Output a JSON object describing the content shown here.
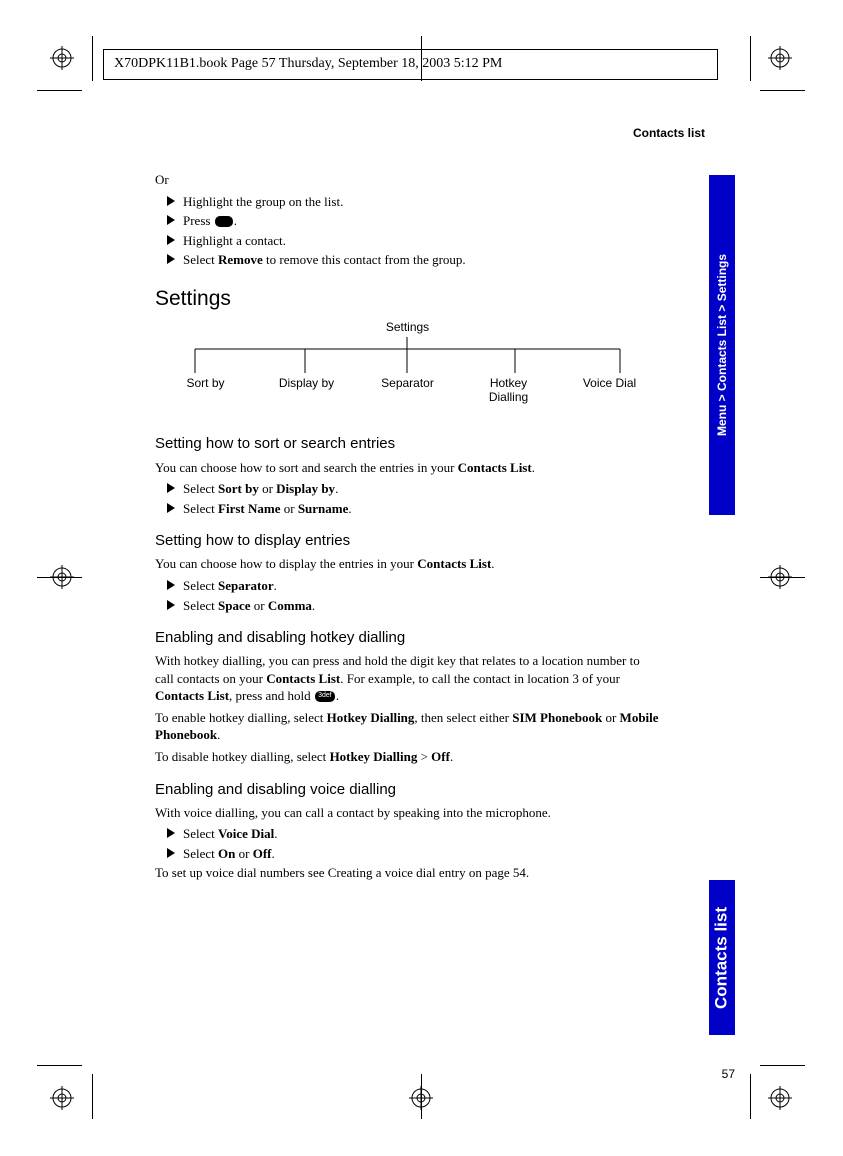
{
  "printHeader": "X70DPK11B1.book  Page 57  Thursday, September 18, 2003  5:12 PM",
  "header": {
    "title": "Contacts list"
  },
  "intro": {
    "or": "Or"
  },
  "steps1": [
    "Highlight the group on the list.",
    "Press ",
    "Highlight a contact.",
    "Select **Remove** to remove this contact from the group."
  ],
  "steps1_press_suffix": ".",
  "settings": {
    "heading": "Settings",
    "treeRoot": "Settings",
    "leaves": [
      "Sort by",
      "Display by",
      "Separator",
      "Hotkey Dialling",
      "Voice Dial"
    ]
  },
  "sortSearch": {
    "sub": "Setting how to sort or search entries",
    "intro": "You can choose how to sort and search the entries in your **Contacts List**.",
    "b1": "Select **Sort by** or **Display by**.",
    "b2": "Select **First Name** or **Surname**."
  },
  "display": {
    "sub": "Setting how to display entries",
    "intro": "You can choose how to display the entries in your **Contacts List**.",
    "b1": "Select **Separator**.",
    "b2": "Select **Space** or **Comma**."
  },
  "hotkey": {
    "sub": "Enabling and disabling hotkey dialling",
    "p1a": "With hotkey dialling, you can press and hold the digit key that relates to a location number to call contacts on your ",
    "p1bold1": "Contacts List",
    "p1b": ". For example, to call the contact in location 3 of your ",
    "p1bold2": "Contacts List",
    "p1c": ", press and hold ",
    "p1d": ".",
    "p2": "To enable hotkey dialling, select **Hotkey Dialling**, then select either **SIM Phonebook** or **Mobile Phonebook**.",
    "p3": "To disable hotkey dialling, select **Hotkey Dialling** > **Off**."
  },
  "voice": {
    "sub": "Enabling and disabling voice dialling",
    "p1": "With voice dialling, you can call a contact by speaking into the microphone.",
    "b1": "Select **Voice Dial**.",
    "b2": "Select **On** or **Off**.",
    "p2": "To set up voice dial numbers see Creating a voice dial entry on page 54."
  },
  "tabs": {
    "breadcrumb": "Menu > Contacts List > Settings",
    "section": "Contacts list"
  },
  "pageNum": "57"
}
